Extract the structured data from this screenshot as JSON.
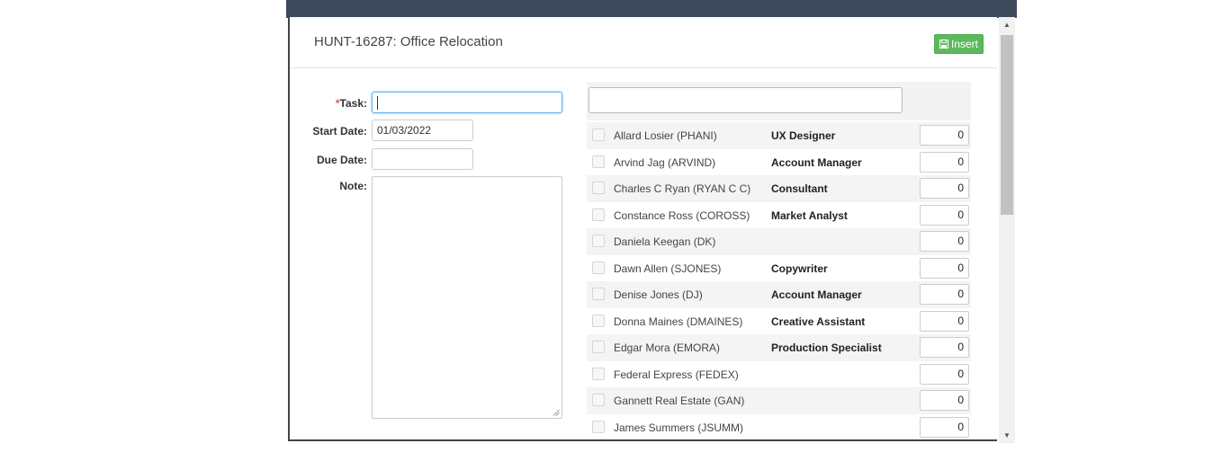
{
  "modal": {
    "title": "HUNT-16287: Office Relocation",
    "insert_label": "Insert"
  },
  "form": {
    "task_label": "Task:",
    "task_required_mark": "*",
    "task_value": "",
    "start_date_label": "Start Date:",
    "start_date_value": "01/03/2022",
    "due_date_label": "Due Date:",
    "due_date_value": "",
    "note_label": "Note:",
    "note_value": ""
  },
  "assignees": {
    "filter_value": "",
    "rows": [
      {
        "name": "Allard Losier (PHANI)",
        "role": "UX Designer",
        "qty": "0"
      },
      {
        "name": "Arvind Jag (ARVIND)",
        "role": "Account Manager",
        "qty": "0"
      },
      {
        "name": "Charles C Ryan (RYAN C C)",
        "role": "Consultant",
        "qty": "0"
      },
      {
        "name": "Constance Ross (COROSS)",
        "role": "Market Analyst",
        "qty": "0"
      },
      {
        "name": "Daniela Keegan (DK)",
        "role": "",
        "qty": "0"
      },
      {
        "name": "Dawn Allen (SJONES)",
        "role": "Copywriter",
        "qty": "0"
      },
      {
        "name": "Denise Jones (DJ)",
        "role": "Account Manager",
        "qty": "0"
      },
      {
        "name": "Donna Maines (DMAINES)",
        "role": "Creative Assistant",
        "qty": "0"
      },
      {
        "name": "Edgar Mora (EMORA)",
        "role": "Production Specialist",
        "qty": "0"
      },
      {
        "name": "Federal Express (FEDEX)",
        "role": "",
        "qty": "0"
      },
      {
        "name": "Gannett Real Estate (GAN)",
        "role": "",
        "qty": "0"
      },
      {
        "name": "James Summers (JSUMM)",
        "role": "",
        "qty": "0"
      }
    ]
  },
  "colors": {
    "insert_button": "#5cb85c",
    "required_mark": "#d9534f",
    "focus_border": "#66afe9"
  }
}
